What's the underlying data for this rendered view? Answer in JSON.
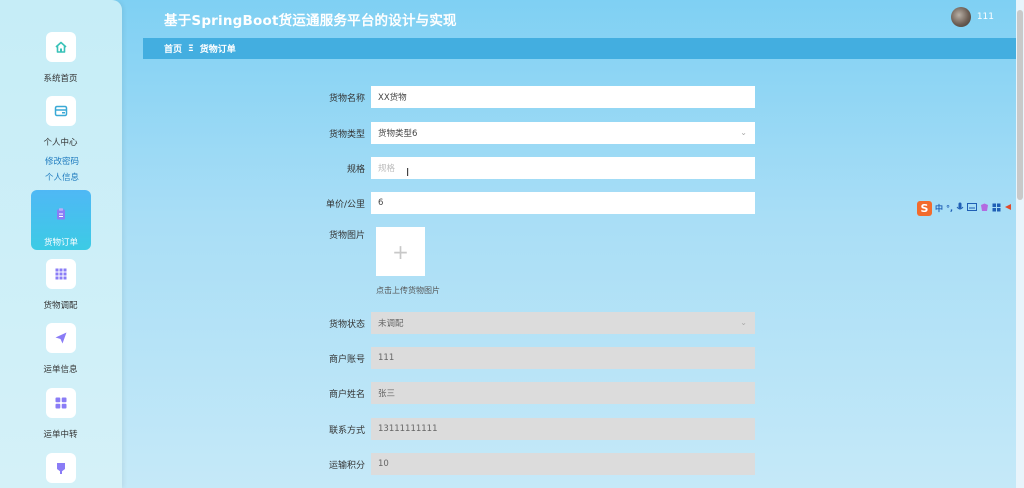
{
  "header": {
    "title": "基于SpringBoot货运通服务平台的设计与实现",
    "user_name": "111"
  },
  "breadcrumb": {
    "home": "首页",
    "separator": "Ξ",
    "current": "货物订单"
  },
  "sidebar": {
    "items": [
      {
        "label": "系统首页",
        "icon": "home-icon"
      },
      {
        "label": "个人中心",
        "icon": "wallet-icon"
      },
      {
        "label": "货物订单",
        "icon": "clipboard-icon",
        "active": true
      },
      {
        "label": "货物调配",
        "icon": "grid-icon"
      },
      {
        "label": "运单信息",
        "icon": "send-icon"
      },
      {
        "label": "运单中转",
        "icon": "apps-icon"
      },
      {
        "label": "",
        "icon": "tag-icon"
      }
    ],
    "sub_items": [
      "修改密码",
      "个人信息"
    ]
  },
  "form": {
    "fields": [
      {
        "label": "货物名称",
        "value": "XX货物"
      },
      {
        "label": "货物类型",
        "value": "货物类型6"
      },
      {
        "label": "规格",
        "value": "",
        "placeholder": "规格"
      },
      {
        "label": "单价/公里",
        "value": "6"
      },
      {
        "label": "货物图片",
        "upload_hint": "点击上传货物图片"
      },
      {
        "label": "货物状态",
        "value": "未调配"
      },
      {
        "label": "商户账号",
        "value": "111"
      },
      {
        "label": "商户姓名",
        "value": "张三"
      },
      {
        "label": "联系方式",
        "value": "13111111111"
      },
      {
        "label": "运输积分",
        "value": "10"
      }
    ]
  },
  "ime": {
    "logo": "S",
    "mode": "中",
    "punct": "°,"
  },
  "colors": {
    "accent": "#43aee0",
    "active_nav": "#4fb8f5",
    "icon_purple": "#8a7cf6"
  }
}
